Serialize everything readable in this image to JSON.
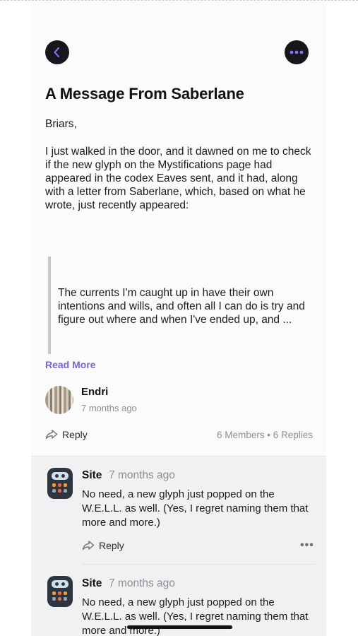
{
  "post": {
    "title": "A Message From Saberlane",
    "greeting": "Briars,",
    "paragraph": "I just walked in the door, and it dawned on me to check if the new glyph on the Mystifications page had appeared in the codex Eaves sent, and it had, along with a letter from Saberlane, which, based on what he wrote, just recently appeared:",
    "quote": "The currents I'm caught up in have their own intentions and wills, and often all I can do is try and figure out where and when I've ended up, and ...",
    "read_more": "Read More",
    "author": "Endri",
    "time": "7 months ago",
    "reply_label": "Reply",
    "stats": "6 Members • 6 Replies"
  },
  "comments": [
    {
      "name": "Site",
      "time": "7 months ago",
      "text": "No need, a new glyph just popped on the W.E.L.L. as well. (Yes, I regret naming them that more and more.)",
      "reply_label": "Reply",
      "more": "•••"
    },
    {
      "name": "Site",
      "time": "7 months ago",
      "text": "No need, a new glyph just popped on the W.E.L.L. as well. (Yes, I regret naming them that more and more.)"
    }
  ],
  "colors": {
    "accent": "#7b61d1",
    "button_bg": "#16161c",
    "muted": "#8e8e93"
  },
  "icons": {
    "back": "chevron-left-icon",
    "more": "more-dots-icon",
    "reply": "reply-arrow-icon"
  }
}
